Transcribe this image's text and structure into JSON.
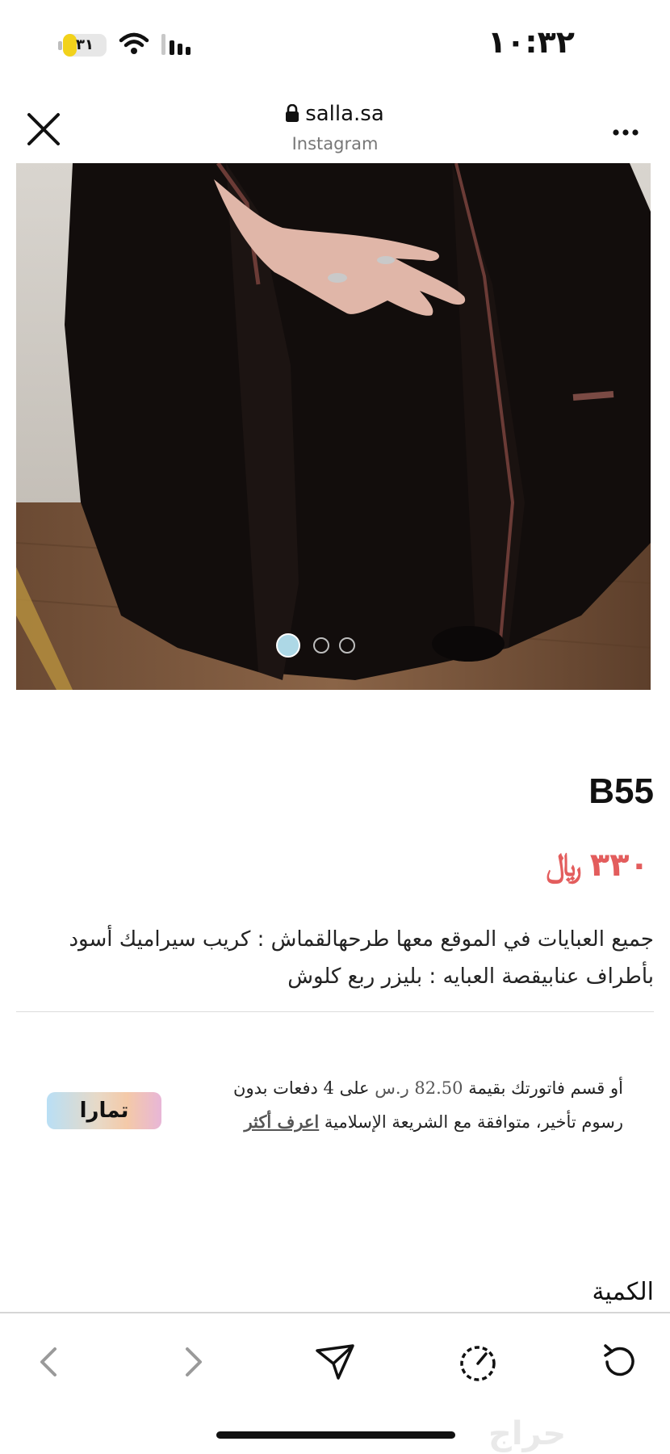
{
  "status_bar": {
    "time": "١٠:٣٢",
    "battery": "٣١",
    "battery_level": 0.31
  },
  "browser": {
    "domain": "salla.sa",
    "source": "Instagram"
  },
  "carousel": {
    "total": 3,
    "active_index": 0,
    "active_color": "#add8e6"
  },
  "product": {
    "title": "B55",
    "price_value": "٣٣٠",
    "currency_symbol": "﷼",
    "price_color": "#e35d5d",
    "description_line1": "جميع العبايات في الموقع معها طرحهالقماش : كريب سيراميك أسود",
    "description_line2": "بأطراف عنابيقصة العبايه : بليزر ربع كلوش"
  },
  "installment": {
    "line1_prefix": "أو قسم فاتورتك بقيمة",
    "amount": "82.50 ر.س",
    "line1_suffix": "على 4 دفعات بدون",
    "line2": "رسوم تأخير، متوافقة مع الشريعة الإسلامية",
    "learn_more": "اعرف أكثر",
    "provider": "تمارا"
  },
  "quantity_label": "الكمية",
  "watermark": "حراج",
  "icons": {
    "close": "close-icon",
    "lock": "lock-icon",
    "more": "more-icon",
    "back": "back-arrow-icon",
    "forward": "forward-arrow-icon",
    "share": "share-icon",
    "timer": "timer-icon",
    "reload": "reload-icon"
  }
}
